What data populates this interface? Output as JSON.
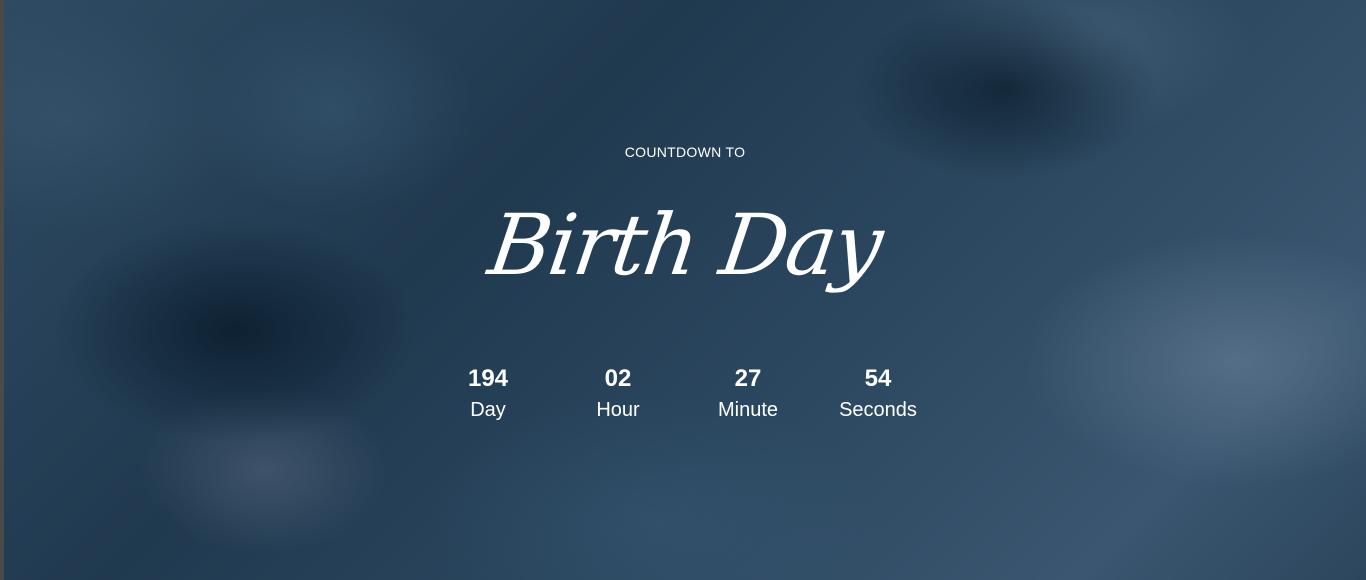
{
  "hero": {
    "eyebrow": "COUNTDOWN TO",
    "title": "Birth Day"
  },
  "countdown": [
    {
      "value": "194",
      "label": "Day"
    },
    {
      "value": "02",
      "label": "Hour"
    },
    {
      "value": "27",
      "label": "Minute"
    },
    {
      "value": "54",
      "label": "Seconds"
    }
  ],
  "colors": {
    "text": "#ffffff",
    "background": "#2b4760"
  }
}
